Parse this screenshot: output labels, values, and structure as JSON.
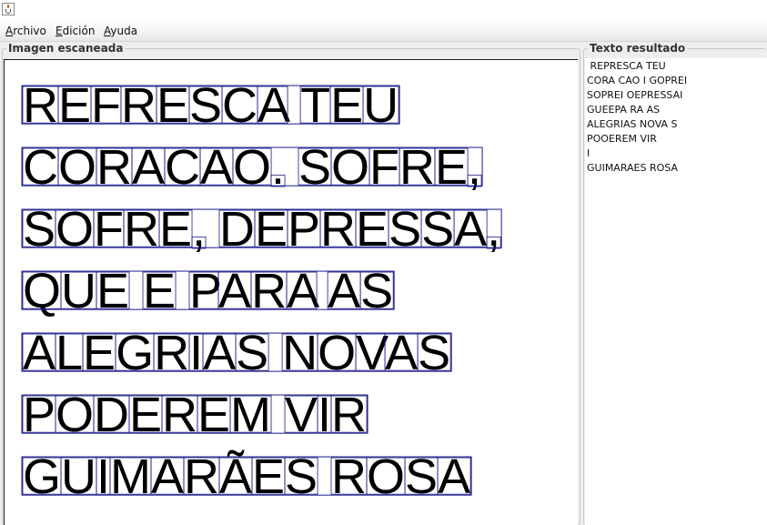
{
  "menubar": {
    "items": [
      "Archivo",
      "Edición",
      "Ayuda"
    ]
  },
  "left_panel": {
    "title": "Imagen escaneada",
    "scanned_lines": [
      "REFRESCA TEU",
      "CORACAO. SOFRE,",
      "SOFRE, DEPRESSA,",
      "QUE E PARA AS",
      "ALEGRIAS NOVAS",
      "PODEREM VIR",
      "GUIMARÃES ROSA"
    ],
    "box_color": "#1a1a8a",
    "text_color": "#000000"
  },
  "right_panel": {
    "title": "Texto resultado",
    "result_lines": [
      " REPRESCA TEU",
      "CORA CAO I GOPREI",
      "SOPREI OEPRESSAI",
      "GUEEPA RA AS",
      "ALEGRIAS NOVA S",
      "POOEREM VIR",
      "I",
      "GUIMARAES ROSA"
    ]
  }
}
